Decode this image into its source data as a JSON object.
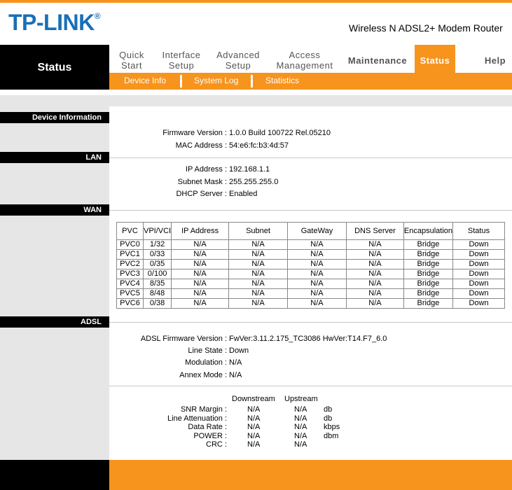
{
  "brand": {
    "logo_text": "TP-LINK",
    "logo_mark": "®",
    "product_name": "Wireless N ADSL2+ Modem Router"
  },
  "nav": {
    "current": "Status",
    "items": [
      {
        "line1": "Quick",
        "line2": "Start"
      },
      {
        "line1": "Interface",
        "line2": "Setup"
      },
      {
        "line1": "Advanced",
        "line2": "Setup"
      },
      {
        "line1": "Access",
        "line2": "Management"
      },
      {
        "line1": "Maintenance"
      },
      {
        "line1": "Status"
      },
      {
        "line1": "Help"
      }
    ],
    "sub_items": [
      "Device Info",
      "System Log",
      "Statistics"
    ]
  },
  "colors": {
    "accent": "#f7941d",
    "brand_blue": "#1a6fb6"
  },
  "sections": {
    "device": "Device Information",
    "lan": "LAN",
    "wan": "WAN",
    "adsl": "ADSL"
  },
  "device": {
    "firmware_label": "Firmware Version :",
    "firmware_value": "1.0.0 Build 100722 Rel.05210",
    "mac_label": "MAC Address :",
    "mac_value": "54:e6:fc:b3:4d:57"
  },
  "lan": {
    "ip_label": "IP Address :",
    "ip_value": "192.168.1.1",
    "mask_label": "Subnet Mask :",
    "mask_value": "255.255.255.0",
    "dhcp_label": "DHCP Server :",
    "dhcp_value": "Enabled"
  },
  "wan": {
    "headers": [
      "PVC",
      "VPI/VCI",
      "IP Address",
      "Subnet",
      "GateWay",
      "DNS Server",
      "Encapsulation",
      "Status"
    ],
    "rows": [
      [
        "PVC0",
        "1/32",
        "N/A",
        "N/A",
        "N/A",
        "N/A",
        "Bridge",
        "Down"
      ],
      [
        "PVC1",
        "0/33",
        "N/A",
        "N/A",
        "N/A",
        "N/A",
        "Bridge",
        "Down"
      ],
      [
        "PVC2",
        "0/35",
        "N/A",
        "N/A",
        "N/A",
        "N/A",
        "Bridge",
        "Down"
      ],
      [
        "PVC3",
        "0/100",
        "N/A",
        "N/A",
        "N/A",
        "N/A",
        "Bridge",
        "Down"
      ],
      [
        "PVC4",
        "8/35",
        "N/A",
        "N/A",
        "N/A",
        "N/A",
        "Bridge",
        "Down"
      ],
      [
        "PVC5",
        "8/48",
        "N/A",
        "N/A",
        "N/A",
        "N/A",
        "Bridge",
        "Down"
      ],
      [
        "PVC6",
        "0/38",
        "N/A",
        "N/A",
        "N/A",
        "N/A",
        "Bridge",
        "Down"
      ]
    ]
  },
  "adsl": {
    "fw_label": "ADSL Firmware Version :",
    "fw_value": "FwVer:3.11.2.175_TC3086 HwVer:T14.F7_6.0",
    "line_label": "Line State :",
    "line_value": "Down",
    "mod_label": "Modulation :",
    "mod_value": "N/A",
    "annex_label": "Annex Mode :",
    "annex_value": "N/A",
    "stats_headers": {
      "down": "Downstream",
      "up": "Upstream"
    },
    "stats": [
      {
        "label": "SNR Margin :",
        "down": "N/A",
        "up": "N/A",
        "unit": "db"
      },
      {
        "label": "Line Attenuation :",
        "down": "N/A",
        "up": "N/A",
        "unit": "db"
      },
      {
        "label": "Data Rate :",
        "down": "N/A",
        "up": "N/A",
        "unit": "kbps"
      },
      {
        "label": "POWER :",
        "down": "N/A",
        "up": "N/A",
        "unit": "dbm"
      },
      {
        "label": "CRC :",
        "down": "N/A",
        "up": "N/A",
        "unit": ""
      }
    ]
  }
}
